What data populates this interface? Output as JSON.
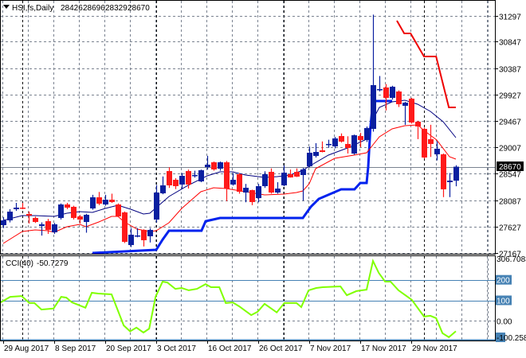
{
  "header": {
    "symbol_label": "HSI,fs,Daily",
    "open": "28426",
    "high": "28696",
    "low": "28329",
    "close": "28670"
  },
  "colors": {
    "bull": "#0a1fa0",
    "bear": "#ff1a1a",
    "ma_fast": "#000080",
    "ma_slow": "#ff0000",
    "channel_low": "#0022ee",
    "channel_high": "#ee0000",
    "cci": "#80ff00",
    "level": "#4682b4",
    "grid": "#7a8290"
  },
  "chart_data": [
    {
      "type": "candlestick",
      "title": "HSI,fs,Daily",
      "ylim": [
        27167,
        31297
      ],
      "y_ticks": [
        31297,
        30847,
        30387,
        29927,
        29467,
        29007,
        28547,
        28087,
        27627,
        27167
      ],
      "current_price": "28670",
      "x_ticks": [
        {
          "idx": 0,
          "label": "29 Aug 2017"
        },
        {
          "idx": 8,
          "label": "8 Sep 2017"
        },
        {
          "idx": 16,
          "label": "20 Sep 2017"
        },
        {
          "idx": 24,
          "label": "3 Oct 2017"
        },
        {
          "idx": 32,
          "label": "16 Oct 2017"
        },
        {
          "idx": 40,
          "label": "26 Oct 2017"
        },
        {
          "idx": 48,
          "label": "7 Nov 2017"
        },
        {
          "idx": 56,
          "label": "17 Nov 2017"
        },
        {
          "idx": 64,
          "label": "29 Nov 2017"
        }
      ],
      "month_separators": [
        3,
        24,
        44,
        66
      ],
      "candles_ohlc": [
        [
          27652,
          27790,
          27600,
          27735
        ],
        [
          27735,
          27930,
          27700,
          27887
        ],
        [
          27930,
          28040,
          27900,
          27957
        ],
        [
          27957,
          28040,
          27930,
          27943
        ],
        [
          27846,
          27890,
          27680,
          27818
        ],
        [
          27777,
          27800,
          27690,
          27707
        ],
        [
          27638,
          27700,
          27470,
          27666
        ],
        [
          27721,
          27760,
          27500,
          27569
        ],
        [
          27527,
          27690,
          27500,
          27666
        ],
        [
          27777,
          28030,
          27750,
          28012
        ],
        [
          28012,
          28040,
          27930,
          27957
        ],
        [
          27971,
          27990,
          27750,
          27777
        ],
        [
          27804,
          27830,
          27680,
          27749
        ],
        [
          27707,
          27850,
          27520,
          27832
        ],
        [
          27943,
          28180,
          27920,
          28137
        ],
        [
          28137,
          28230,
          28000,
          28026
        ],
        [
          28012,
          28180,
          27990,
          28095
        ],
        [
          28095,
          28200,
          28040,
          28054
        ],
        [
          28012,
          28030,
          27790,
          27804
        ],
        [
          27874,
          27890,
          27340,
          27361
        ],
        [
          27305,
          27600,
          27270,
          27485
        ],
        [
          27458,
          27600,
          27440,
          27472
        ],
        [
          27569,
          27580,
          27280,
          27389
        ],
        [
          27458,
          27600,
          27350,
          27569
        ],
        [
          27749,
          28350,
          27700,
          28220
        ],
        [
          28206,
          28500,
          28190,
          28345
        ],
        [
          28594,
          28660,
          28300,
          28345
        ],
        [
          28442,
          28470,
          28280,
          28331
        ],
        [
          28359,
          28560,
          28290,
          28511
        ],
        [
          28594,
          28620,
          28290,
          28359
        ],
        [
          28511,
          28600,
          28480,
          28525
        ],
        [
          28414,
          28620,
          28400,
          28608
        ],
        [
          28663,
          28860,
          28620,
          28705
        ],
        [
          28747,
          28760,
          28600,
          28622
        ],
        [
          28636,
          28760,
          28600,
          28747
        ],
        [
          28747,
          28770,
          28070,
          28289
        ],
        [
          28359,
          28560,
          28340,
          28442
        ],
        [
          28539,
          28560,
          28200,
          28234
        ],
        [
          28220,
          28370,
          28050,
          28303
        ],
        [
          28262,
          28270,
          28000,
          28054
        ],
        [
          28123,
          28370,
          28050,
          28331
        ],
        [
          28331,
          28590,
          28300,
          28539
        ],
        [
          28580,
          28640,
          28200,
          28220
        ],
        [
          28220,
          28400,
          28200,
          28289
        ],
        [
          28345,
          28690,
          28330,
          28566
        ],
        [
          28539,
          28620,
          28480,
          28483
        ],
        [
          28580,
          28640,
          28490,
          28497
        ],
        [
          28525,
          28650,
          28080,
          28622
        ],
        [
          28677,
          29020,
          28660,
          28913
        ],
        [
          28858,
          29080,
          28830,
          28927
        ],
        [
          28955,
          29110,
          28920,
          28927
        ],
        [
          29052,
          29140,
          29000,
          29066
        ],
        [
          29024,
          29190,
          28990,
          29163
        ],
        [
          29204,
          29250,
          29090,
          29107
        ],
        [
          29066,
          29200,
          28900,
          28996
        ],
        [
          28899,
          29230,
          28880,
          29218
        ],
        [
          29204,
          29260,
          29010,
          29135
        ],
        [
          29135,
          29370,
          29100,
          29343
        ],
        [
          29329,
          31320,
          29280,
          30091
        ],
        [
          30008,
          30250,
          29980,
          30022
        ],
        [
          30050,
          30110,
          29650,
          29869
        ],
        [
          29869,
          30080,
          29840,
          30063
        ],
        [
          29980,
          30000,
          29710,
          29758
        ],
        [
          29731,
          29800,
          29400,
          29786
        ],
        [
          29855,
          29870,
          29420,
          29440
        ],
        [
          29454,
          29470,
          29150,
          29371
        ],
        [
          29329,
          29350,
          28810,
          28830
        ],
        [
          29149,
          29400,
          28840,
          29066
        ],
        [
          28886,
          29110,
          28780,
          28983
        ],
        [
          28886,
          28900,
          28140,
          28276
        ],
        [
          28400,
          28560,
          28140,
          28428
        ],
        [
          28426,
          28696,
          28329,
          28670
        ]
      ],
      "ma_fast": [
        [
          0,
          27735
        ],
        [
          3,
          27818
        ],
        [
          5,
          27818
        ],
        [
          8,
          27804
        ],
        [
          10,
          27860
        ],
        [
          12,
          27887
        ],
        [
          14,
          27874
        ],
        [
          16,
          27943
        ],
        [
          18,
          27998
        ],
        [
          20,
          27929
        ],
        [
          22,
          27846
        ],
        [
          23,
          27860
        ],
        [
          26,
          28151
        ],
        [
          29,
          28345
        ],
        [
          32,
          28511
        ],
        [
          34,
          28580
        ],
        [
          36,
          28580
        ],
        [
          38,
          28525
        ],
        [
          41,
          28483
        ],
        [
          43,
          28497
        ],
        [
          45,
          28525
        ],
        [
          47,
          28608
        ],
        [
          48,
          28677
        ],
        [
          51,
          28871
        ],
        [
          54,
          28996
        ],
        [
          57,
          29149
        ],
        [
          58,
          29495
        ],
        [
          59,
          29703
        ],
        [
          61,
          29800
        ],
        [
          63,
          29828
        ],
        [
          65,
          29758
        ],
        [
          67,
          29634
        ],
        [
          69,
          29454
        ],
        [
          71,
          29176
        ]
      ],
      "ma_slow": [
        [
          0,
          27333
        ],
        [
          3,
          27541
        ],
        [
          5,
          27569
        ],
        [
          7,
          27555
        ],
        [
          8,
          27527
        ],
        [
          10,
          27624
        ],
        [
          12,
          27666
        ],
        [
          13,
          27624
        ],
        [
          15,
          27707
        ],
        [
          17,
          27804
        ],
        [
          18,
          27804
        ],
        [
          19,
          27707
        ],
        [
          21,
          27583
        ],
        [
          23,
          27541
        ],
        [
          24,
          27555
        ],
        [
          26,
          27694
        ],
        [
          28,
          27943
        ],
        [
          31,
          28234
        ],
        [
          33,
          28303
        ],
        [
          35,
          28289
        ],
        [
          38,
          28234
        ],
        [
          41,
          28178
        ],
        [
          44,
          28192
        ],
        [
          46,
          28220
        ],
        [
          47,
          28248
        ],
        [
          48,
          28373
        ],
        [
          49,
          28636
        ],
        [
          52,
          28816
        ],
        [
          55,
          28871
        ],
        [
          57,
          28913
        ],
        [
          58,
          29052
        ],
        [
          59,
          29190
        ],
        [
          61,
          29329
        ],
        [
          63,
          29384
        ],
        [
          65,
          29398
        ],
        [
          66,
          29301
        ],
        [
          68,
          29135
        ],
        [
          70,
          28844
        ],
        [
          71,
          28802
        ]
      ],
      "channel_low": [
        [
          14,
          27167
        ],
        [
          24,
          27222
        ],
        [
          25,
          27400
        ],
        [
          26,
          27555
        ],
        [
          31.1,
          27555
        ],
        [
          31.75,
          27720
        ],
        [
          34,
          27777
        ],
        [
          47,
          27777
        ],
        [
          48.25,
          27971
        ],
        [
          49.5,
          28109
        ],
        [
          53,
          28275
        ],
        [
          55.1,
          28275
        ],
        [
          56,
          28386
        ],
        [
          57,
          28386
        ],
        [
          57.25,
          28663
        ],
        [
          57.6,
          29357
        ],
        [
          58,
          29814
        ],
        [
          61,
          29814
        ]
      ],
      "channel_high": [
        [
          61.75,
          31214
        ],
        [
          62.9,
          30992
        ],
        [
          63.9,
          30992
        ],
        [
          66,
          30590
        ],
        [
          67.9,
          30590
        ],
        [
          69.9,
          29703
        ],
        [
          71,
          29703
        ]
      ]
    },
    {
      "type": "line",
      "title": "CCI(40)",
      "current_value": "-50.7279",
      "ylim": [
        -100.258,
        306.7083
      ],
      "y_labels": [
        "306.7083",
        "200",
        "100",
        "0.00",
        "-100.258"
      ],
      "levels": [
        200,
        100,
        0,
        -100
      ],
      "values": [
        [
          -0.4,
          90
        ],
        [
          1.1,
          117
        ],
        [
          2.9,
          121
        ],
        [
          4.1,
          87
        ],
        [
          4.9,
          87
        ],
        [
          6,
          55
        ],
        [
          7.9,
          60
        ],
        [
          9.1,
          117
        ],
        [
          9.9,
          113
        ],
        [
          10.8,
          90
        ],
        [
          12.9,
          64
        ],
        [
          13.9,
          137
        ],
        [
          14.9,
          133
        ],
        [
          17,
          129
        ],
        [
          18.9,
          -22
        ],
        [
          19.9,
          -51
        ],
        [
          20.9,
          -33
        ],
        [
          22,
          -57
        ],
        [
          22.9,
          -38
        ],
        [
          23.9,
          117
        ],
        [
          25,
          191
        ],
        [
          25.75,
          187
        ],
        [
          27,
          156
        ],
        [
          28,
          160
        ],
        [
          29.1,
          149
        ],
        [
          30.4,
          156
        ],
        [
          31.75,
          179
        ],
        [
          32.6,
          164
        ],
        [
          33.9,
          164
        ],
        [
          34.9,
          87
        ],
        [
          36,
          90
        ],
        [
          37,
          71
        ],
        [
          38.9,
          28
        ],
        [
          39.9,
          44
        ],
        [
          41,
          83
        ],
        [
          42.9,
          41
        ],
        [
          44.1,
          87
        ],
        [
          46,
          87
        ],
        [
          46.75,
          67
        ],
        [
          47.9,
          149
        ],
        [
          49.1,
          160
        ],
        [
          50.1,
          164
        ],
        [
          52.9,
          168
        ],
        [
          53.9,
          125
        ],
        [
          55.4,
          145
        ],
        [
          57,
          152
        ],
        [
          58,
          292
        ],
        [
          58.9,
          234
        ],
        [
          59.9,
          191
        ],
        [
          60.75,
          191
        ],
        [
          62,
          149
        ],
        [
          64.1,
          102
        ],
        [
          66,
          21
        ],
        [
          67,
          25
        ],
        [
          67.9,
          13
        ],
        [
          68.9,
          -60
        ],
        [
          69.9,
          -80
        ],
        [
          71,
          -50.7
        ]
      ]
    }
  ]
}
